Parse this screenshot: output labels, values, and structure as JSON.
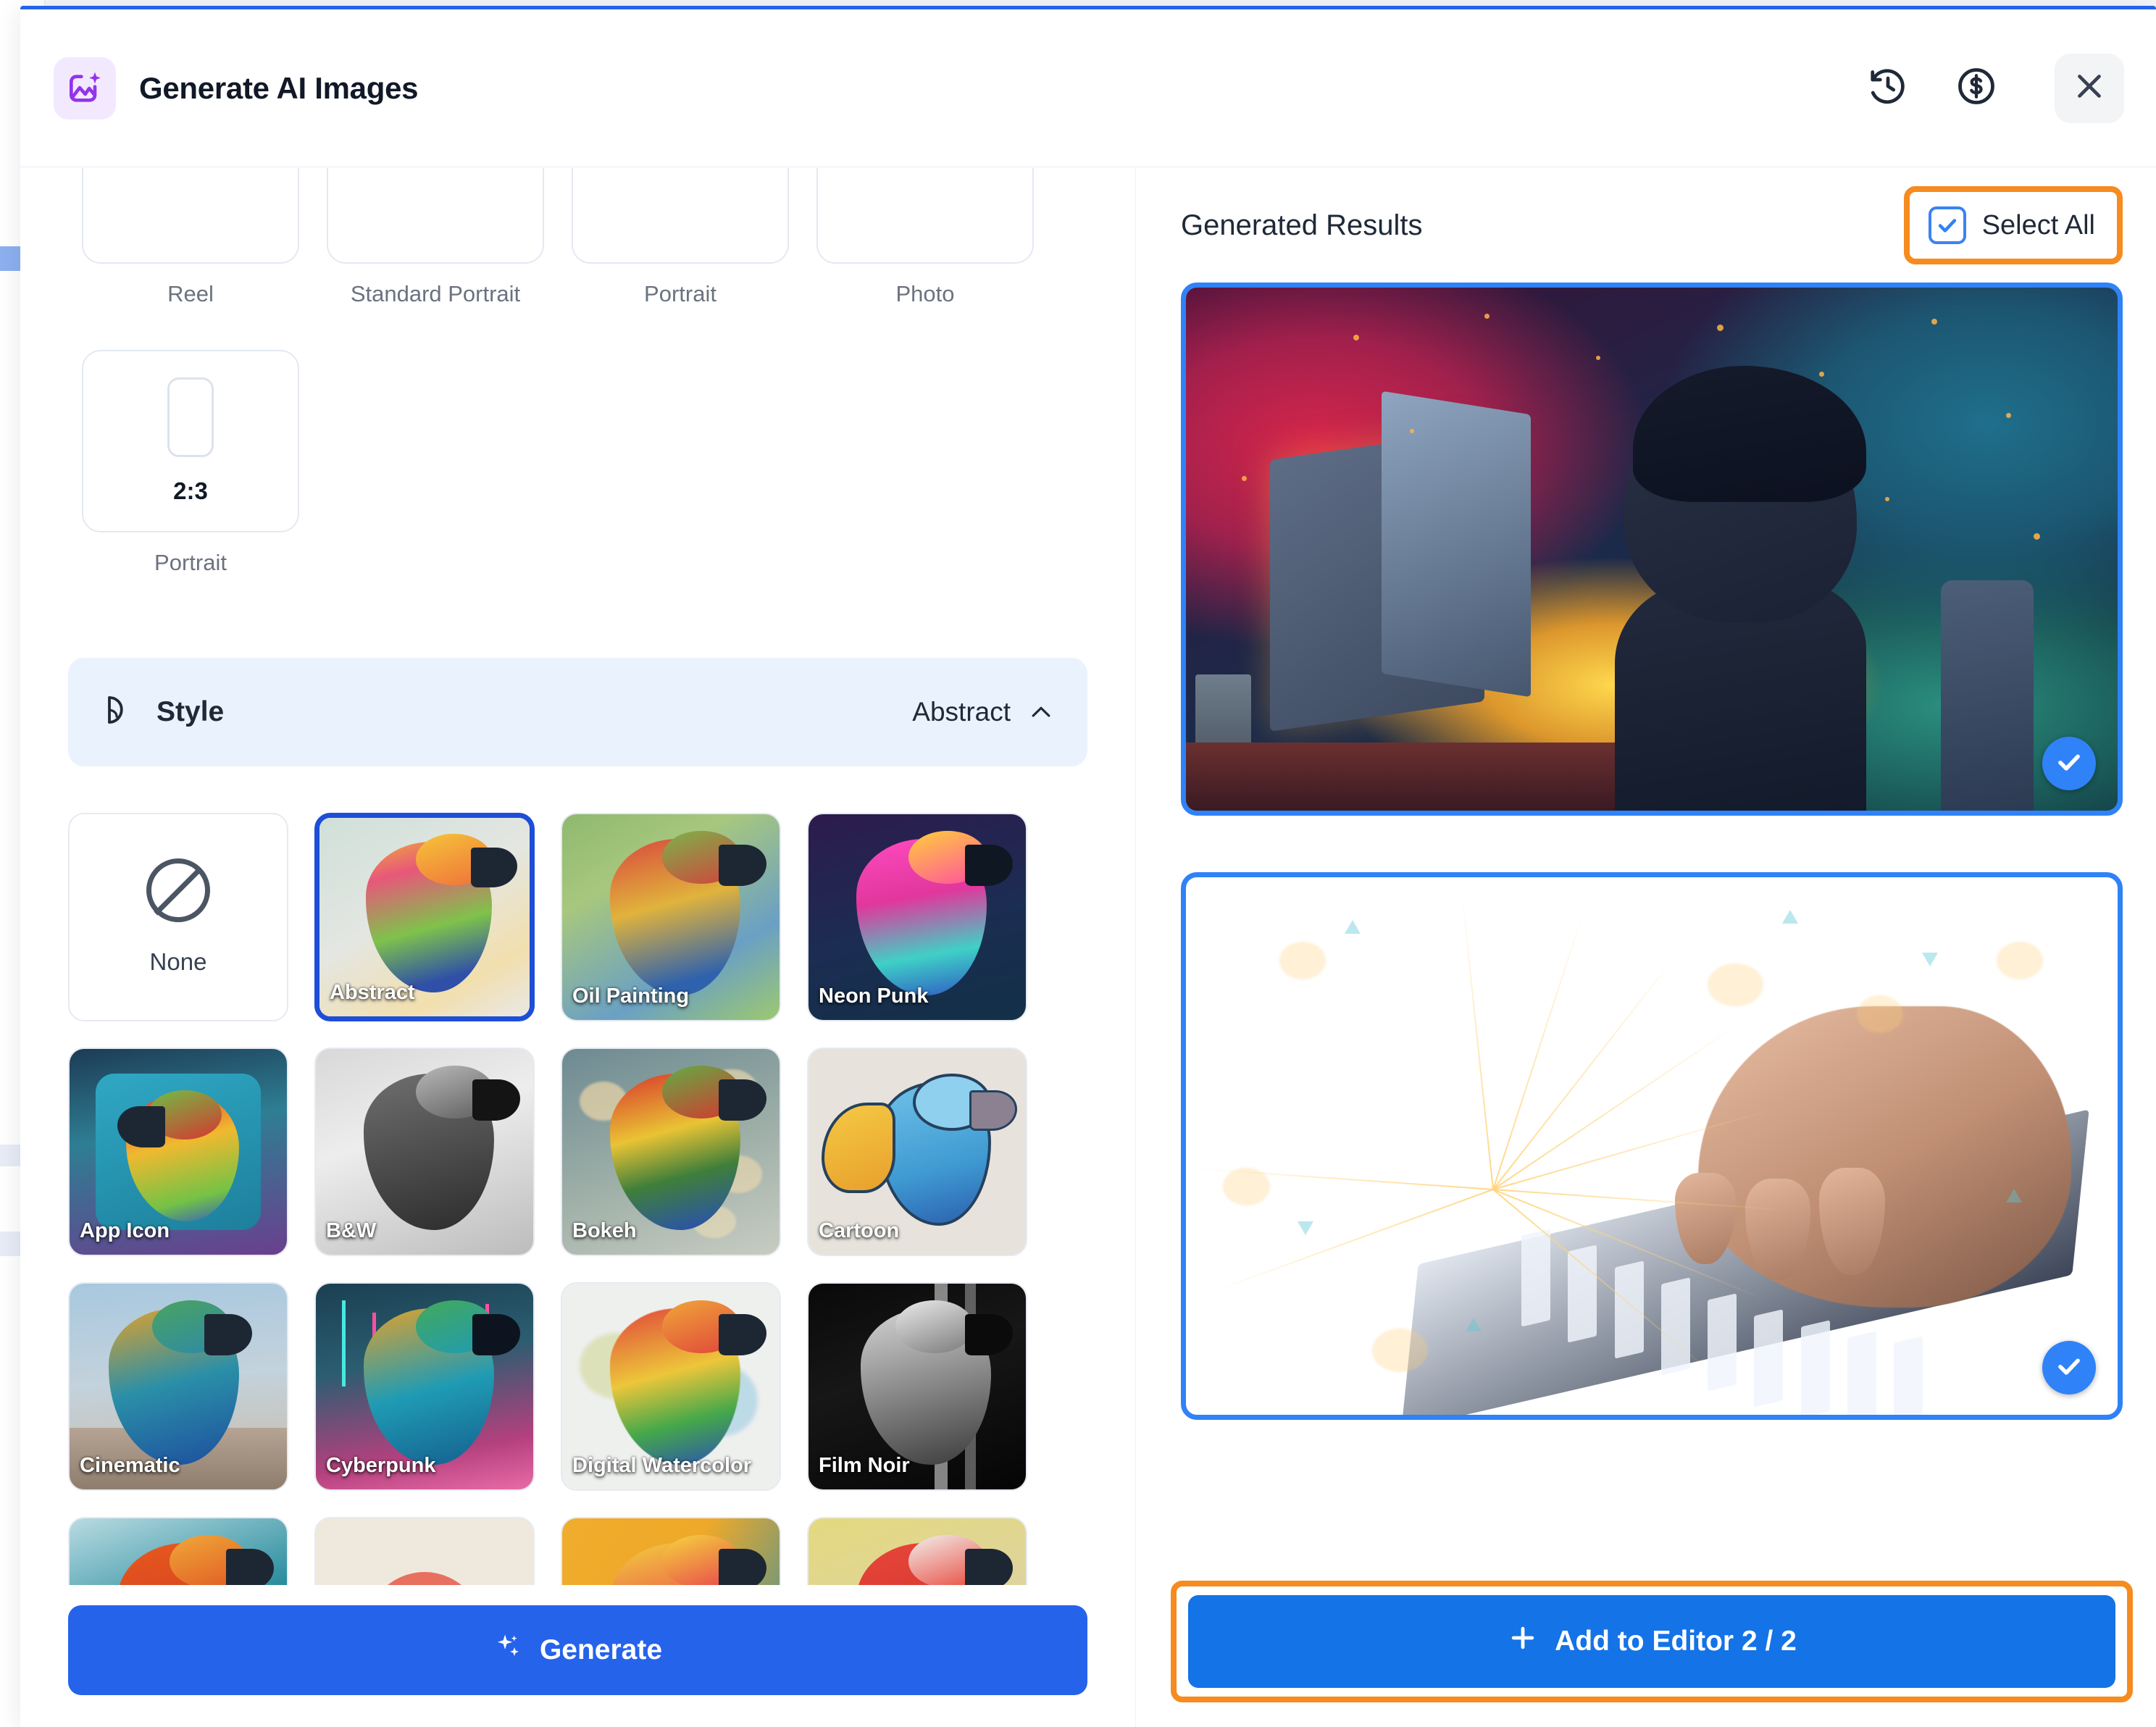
{
  "header": {
    "title": "Generate AI Images",
    "logo_icon": "image-sparkle-icon",
    "actions": [
      {
        "name": "history",
        "icon": "history-clock-icon"
      },
      {
        "name": "credits",
        "icon": "dollar-circle-icon"
      },
      {
        "name": "close",
        "icon": "close-x-icon"
      }
    ]
  },
  "aspect_ratios": {
    "row1": [
      {
        "label": "Reel"
      },
      {
        "label": "Standard Portrait"
      },
      {
        "label": "Portrait"
      },
      {
        "label": "Photo"
      }
    ],
    "row2": [
      {
        "ratio": "2:3",
        "label": "Portrait"
      }
    ]
  },
  "style_section": {
    "icon": "style-palette-icon",
    "title": "Style",
    "value": "Abstract",
    "chevron": "chevron-up-icon",
    "items": [
      {
        "label": "None",
        "icon": "no-style-icon",
        "selected": false,
        "kind": "none"
      },
      {
        "label": "Abstract",
        "selected": true
      },
      {
        "label": "Oil Painting",
        "selected": false
      },
      {
        "label": "Neon Punk",
        "selected": false
      },
      {
        "label": "App Icon",
        "selected": false
      },
      {
        "label": "B&W",
        "selected": false
      },
      {
        "label": "Bokeh",
        "selected": false
      },
      {
        "label": "Cartoon",
        "selected": false
      },
      {
        "label": "Cinematic",
        "selected": false
      },
      {
        "label": "Cyberpunk",
        "selected": false
      },
      {
        "label": "Digital Watercolor",
        "selected": false
      },
      {
        "label": "Film Noir",
        "selected": false
      },
      {
        "label": "",
        "selected": false
      },
      {
        "label": "",
        "selected": false
      },
      {
        "label": "",
        "selected": false
      },
      {
        "label": "",
        "selected": false
      }
    ]
  },
  "generate_button": {
    "label": "Generate",
    "icon": "sparkle-icon"
  },
  "results": {
    "title": "Generated Results",
    "select_all": {
      "label": "Select All",
      "checked": true,
      "highlighted": true
    },
    "items": [
      {
        "name": "boy-at-computer",
        "selected": true,
        "badge_icon": "check-circle-icon"
      },
      {
        "name": "hands-typing-keyboard",
        "selected": true,
        "badge_icon": "check-circle-icon"
      }
    ]
  },
  "add_to_editor_button": {
    "label": "Add to Editor 2 / 2",
    "icon": "plus-icon",
    "highlighted": true
  },
  "colors": {
    "primary_blue": "#2563eb",
    "result_border_blue": "#2f82f7",
    "annotation_orange": "#f68b1f",
    "style_bar_bg": "#eaf2fd",
    "logo_purple": "#9333ea"
  }
}
